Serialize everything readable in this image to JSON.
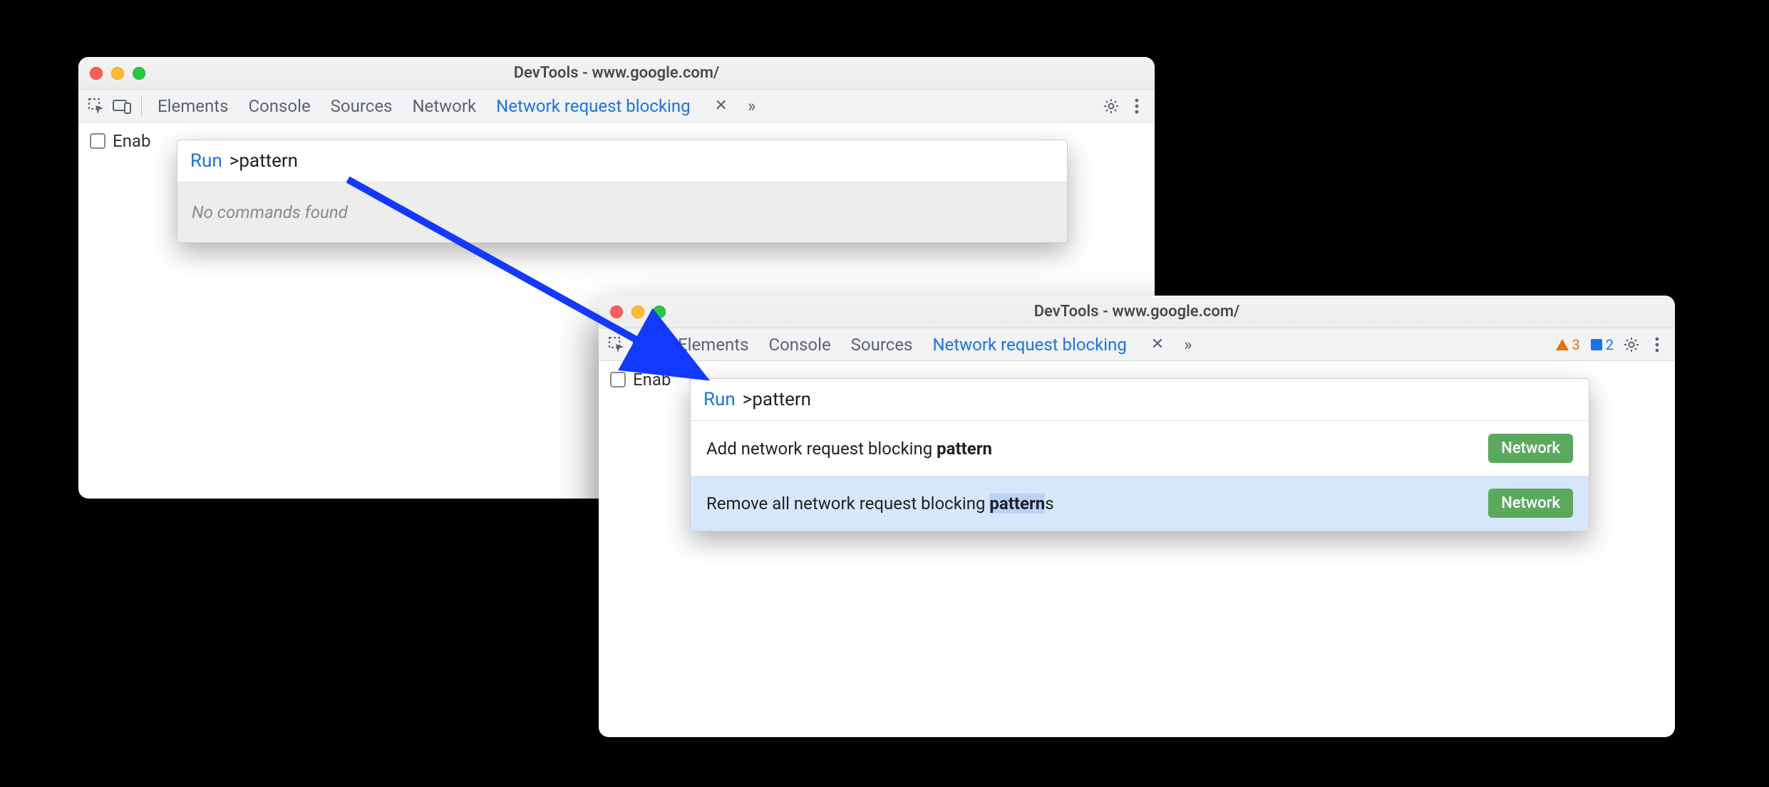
{
  "arrow": {
    "color": "#1338ff"
  },
  "win1": {
    "title": "DevTools - www.google.com/",
    "tabs": {
      "elements": "Elements",
      "console": "Console",
      "sources": "Sources",
      "network": "Network",
      "blocking": "Network request blocking"
    },
    "enable_label": "Enab",
    "cmd": {
      "run": "Run",
      "prefix": ">",
      "value": "pattern",
      "empty": "No commands found"
    }
  },
  "win2": {
    "title": "DevTools - www.google.com/",
    "tabs": {
      "elements": "Elements",
      "console": "Console",
      "sources": "Sources",
      "blocking": "Network request blocking"
    },
    "warn_count": "3",
    "issue_count": "2",
    "enable_label": "Enab",
    "cmd": {
      "run": "Run",
      "prefix": ">",
      "value": "pattern",
      "items": [
        {
          "pre": "Add network request blocking ",
          "bold": "pattern",
          "post": "",
          "tag": "Network"
        },
        {
          "pre": "Remove all network request blocking ",
          "bold": "pattern",
          "post": "s",
          "tag": "Network"
        }
      ]
    }
  }
}
